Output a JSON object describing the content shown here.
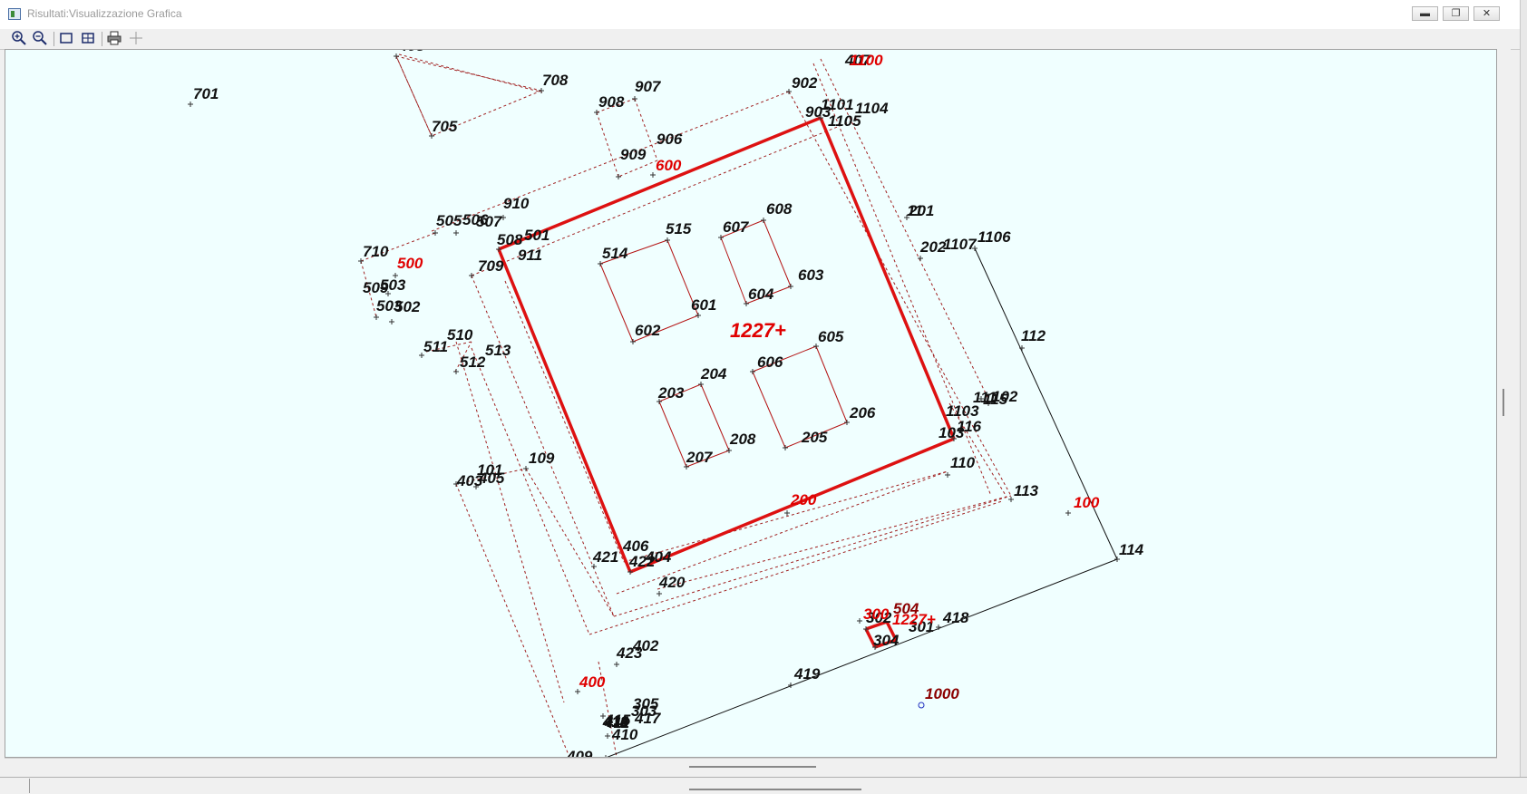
{
  "window": {
    "title": "Risultati:Visualizzazione Grafica",
    "controls": [
      "minimize",
      "restore",
      "close"
    ]
  },
  "toolbar": {
    "buttons": [
      "zoom-in-icon",
      "zoom-out-icon",
      "zoom-window-icon",
      "zoom-extents-icon",
      "print-icon",
      "crosshair-icon"
    ],
    "combo_value": ""
  },
  "plot": {
    "colors": {
      "background": "#f0ffff",
      "black_label": "#111111",
      "red_label": "#e00000",
      "dark_red_label": "#8b0000",
      "red_line": "#dd1111",
      "dashed_line": "#a02020",
      "black_line": "#111111"
    },
    "black_labels": [
      "701",
      "705",
      "708",
      "907",
      "908",
      "906",
      "909",
      "902",
      "903",
      "1101",
      "1104",
      "1105",
      "910",
      "506",
      "507",
      "505",
      "508",
      "501",
      "911",
      "709",
      "710",
      "503",
      "509",
      "503",
      "502",
      "511",
      "510",
      "512",
      "513",
      "514",
      "515",
      "607",
      "608",
      "603",
      "604",
      "601",
      "602",
      "605",
      "606",
      "204",
      "203",
      "208",
      "207",
      "205",
      "206",
      "202",
      "201",
      "11",
      "1107",
      "1106",
      "112",
      "1103",
      "103",
      "116",
      "115",
      "102",
      "111",
      "110",
      "113",
      "114",
      "109",
      "101",
      "403",
      "405",
      "406",
      "404",
      "421",
      "422",
      "420",
      "402",
      "423",
      "419",
      "418",
      "302",
      "301",
      "304",
      "305",
      "303",
      "417",
      "416",
      "415",
      "414",
      "413",
      "412",
      "411",
      "410",
      "409",
      "408",
      "407",
      "401",
      "700",
      "1108"
    ],
    "red_labels": [
      "600",
      "500",
      "1227+",
      "200",
      "100",
      "300",
      "400",
      "1227+",
      "1100"
    ],
    "dark_red_labels": [
      "1000",
      "504"
    ]
  }
}
